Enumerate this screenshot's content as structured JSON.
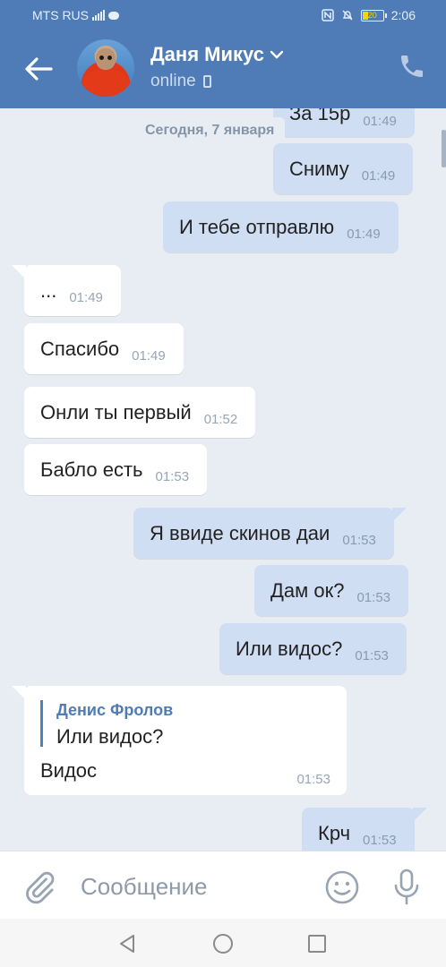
{
  "status_bar": {
    "carrier": "MTS RUS",
    "battery": "20",
    "time": "2:06"
  },
  "header": {
    "peer_name": "Даня Микус",
    "peer_status": "online"
  },
  "date_separator": "Сегодня, 7 января",
  "messages": [
    {
      "dir": "out",
      "text": "За 15р",
      "time": "01:49"
    },
    {
      "dir": "out",
      "text": "Сниму",
      "time": "01:49"
    },
    {
      "dir": "out",
      "text": "И тебе отправлю",
      "time": "01:49"
    },
    {
      "dir": "in",
      "text": "...",
      "time": "01:49"
    },
    {
      "dir": "in",
      "text": "Спасибо",
      "time": "01:49"
    },
    {
      "dir": "in",
      "text": "Онли ты первый",
      "time": "01:52"
    },
    {
      "dir": "in",
      "text": "Бабло есть",
      "time": "01:53"
    },
    {
      "dir": "out",
      "text": "Я ввиде скинов даи",
      "time": "01:53"
    },
    {
      "dir": "out",
      "text": "Дам ок?",
      "time": "01:53"
    },
    {
      "dir": "out",
      "text": "Или видос?",
      "time": "01:53"
    },
    {
      "dir": "out",
      "text": "Крч",
      "time": "01:53"
    }
  ],
  "reply_message": {
    "quoted_author": "Денис Фролов",
    "quoted_text": "Или видос?",
    "text": "Видос",
    "time": "01:53"
  },
  "composer": {
    "placeholder": "Сообщение"
  },
  "colors": {
    "header_bg": "#4f7cb6",
    "incoming_bubble": "#ffffff",
    "outgoing_bubble": "#d0def4",
    "chat_bg": "#e8edf3"
  }
}
